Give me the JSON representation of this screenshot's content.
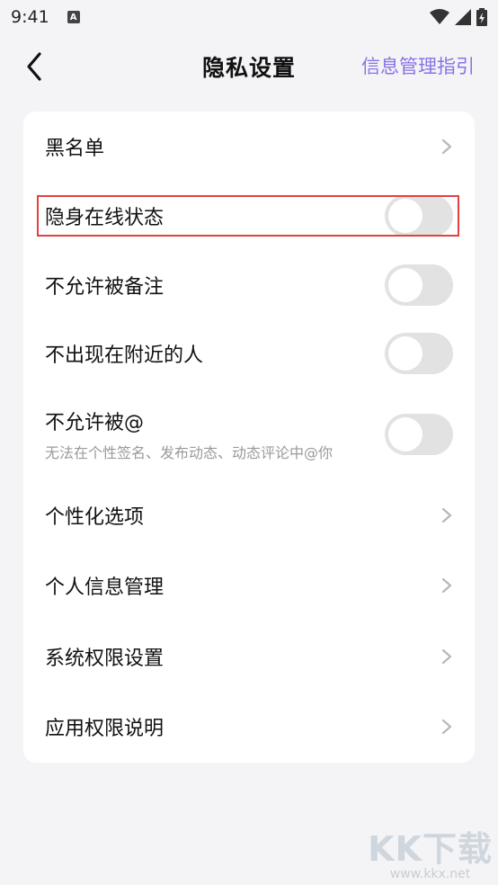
{
  "status_bar": {
    "time": "9:41",
    "notification_letter": "A"
  },
  "nav": {
    "title": "隐私设置",
    "right_link": "信息管理指引"
  },
  "settings": [
    {
      "label": "黑名单",
      "control": "chevron"
    },
    {
      "label": "隐身在线状态",
      "control": "toggle",
      "on": false
    },
    {
      "label": "不允许被备注",
      "control": "toggle",
      "on": false
    },
    {
      "label": "不出现在附近的人",
      "control": "toggle",
      "on": false
    },
    {
      "label": "不允许被@",
      "sub": "无法在个性签名、发布动态、动态评论中@你",
      "control": "toggle",
      "on": false
    },
    {
      "label": "个性化选项",
      "control": "chevron"
    },
    {
      "label": "个人信息管理",
      "control": "chevron"
    },
    {
      "label": "系统权限设置",
      "control": "chevron"
    },
    {
      "label": "应用权限说明",
      "control": "chevron"
    }
  ],
  "watermark": {
    "logo_text": "KK下载",
    "url": "www.kkx.net"
  },
  "colors": {
    "accent": "#8a72e6",
    "highlight": "#e5403e",
    "toggle_off": "#e2e2e2"
  }
}
